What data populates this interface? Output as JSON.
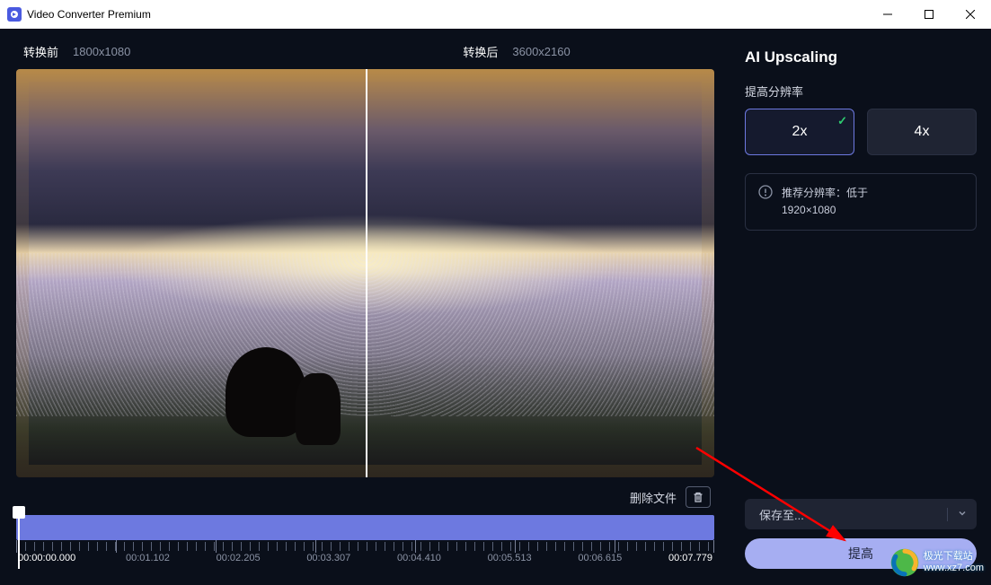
{
  "titlebar": {
    "title": "Video Converter Premium"
  },
  "resolution": {
    "before_label": "转换前",
    "before_value": "1800x1080",
    "after_label": "转换后",
    "after_value": "3600x2160"
  },
  "actions": {
    "delete_label": "删除文件"
  },
  "timeline": {
    "labels": [
      "00:00:00.000",
      "00:01.102",
      "00:02.205",
      "00:03.307",
      "00:04.410",
      "00:05.513",
      "00:06.615",
      "00:07.779"
    ]
  },
  "panel": {
    "title": "AI Upscaling",
    "section_label": "提高分辨率",
    "options": [
      "2x",
      "4x"
    ],
    "info_line1": "推荐分辨率：低于",
    "info_line2": "1920×1080",
    "save_label": "保存至...",
    "enhance_label": "提高"
  },
  "watermark": {
    "line1": "极光下载站",
    "line2": "www.xz7.com"
  }
}
